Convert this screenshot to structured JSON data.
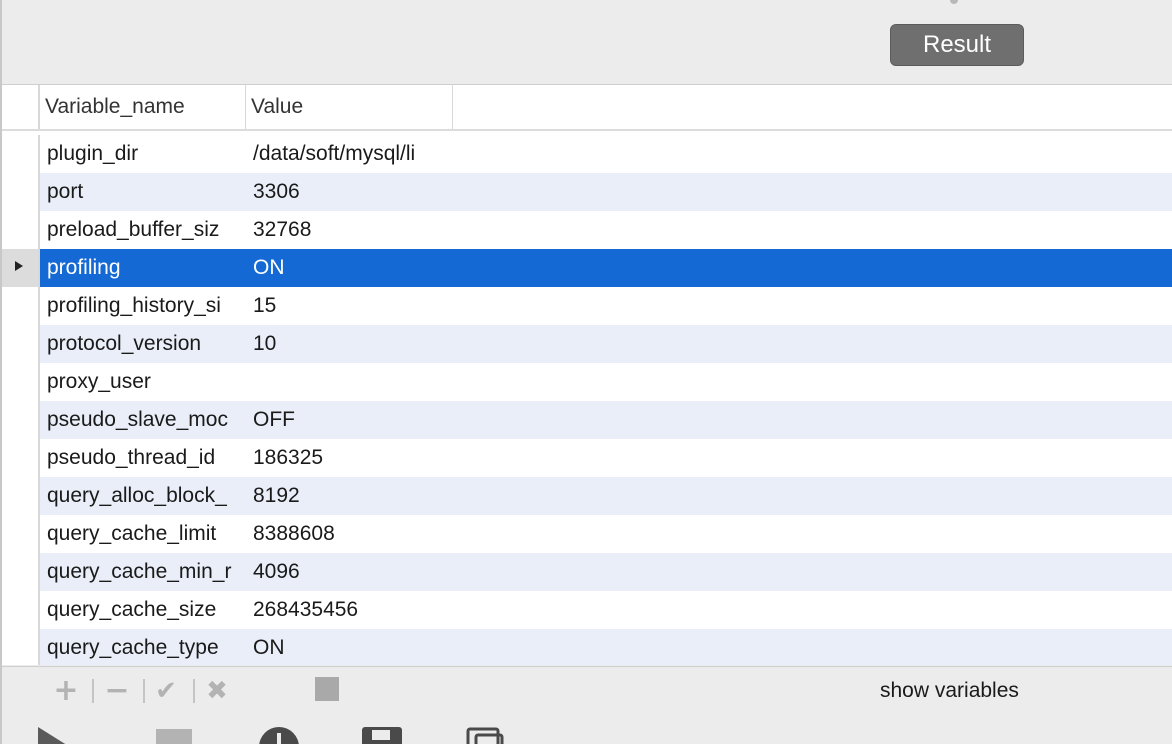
{
  "toolbar": {
    "result_label": "Result"
  },
  "grid": {
    "columns": [
      "Variable_name",
      "Value"
    ],
    "selected_index": 3,
    "rows": [
      {
        "name": "plugin_dir",
        "value": "/data/soft/mysql/li"
      },
      {
        "name": "port",
        "value": "3306"
      },
      {
        "name": "preload_buffer_siz",
        "value": "32768"
      },
      {
        "name": "profiling",
        "value": "ON"
      },
      {
        "name": "profiling_history_si",
        "value": "15"
      },
      {
        "name": "protocol_version",
        "value": "10"
      },
      {
        "name": "proxy_user",
        "value": ""
      },
      {
        "name": "pseudo_slave_moc",
        "value": "OFF"
      },
      {
        "name": "pseudo_thread_id",
        "value": "186325"
      },
      {
        "name": "query_alloc_block_",
        "value": "8192"
      },
      {
        "name": "query_cache_limit",
        "value": "8388608"
      },
      {
        "name": "query_cache_min_r",
        "value": "4096"
      },
      {
        "name": "query_cache_size",
        "value": "268435456"
      },
      {
        "name": "query_cache_type",
        "value": "ON"
      }
    ]
  },
  "editbar": {
    "query_text": "show variables"
  },
  "icons": {
    "add": "plus-icon",
    "remove": "minus-icon",
    "apply": "check-icon",
    "discard": "x-icon",
    "stop": "stop-icon"
  },
  "colors": {
    "selected_row": "#1569d4",
    "alt_row": "#e9eef8",
    "result_button": "#6f6f6f"
  }
}
